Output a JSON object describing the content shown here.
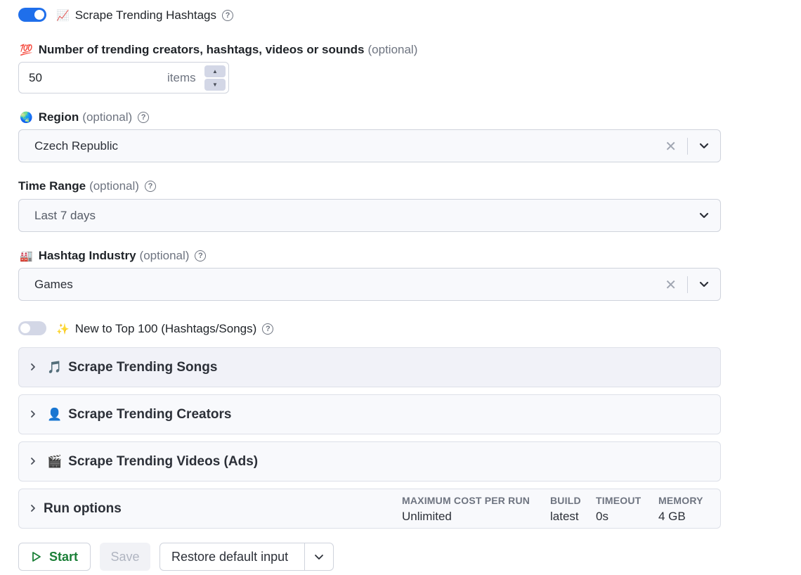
{
  "hashtags_toggle": {
    "label": "Scrape Trending Hashtags",
    "emoji": "📈",
    "enabled": true
  },
  "count_field": {
    "emoji": "💯",
    "label": "Number of trending creators, hashtags, videos or sounds",
    "optional": "(optional)",
    "value": "50",
    "unit": "items"
  },
  "region": {
    "emoji": "🌏",
    "label": "Region",
    "optional": "(optional)",
    "value": "Czech Republic"
  },
  "time_range": {
    "label": "Time Range",
    "optional": "(optional)",
    "value": "Last 7 days"
  },
  "industry": {
    "emoji": "🏭",
    "label": "Hashtag Industry",
    "optional": "(optional)",
    "value": "Games"
  },
  "new_top_toggle": {
    "emoji": "✨",
    "label": "New to Top 100 (Hashtags/Songs)",
    "enabled": false
  },
  "sections": {
    "songs": {
      "emoji": "🎵",
      "title": "Scrape Trending Songs"
    },
    "creators": {
      "emoji": "👤",
      "title": "Scrape Trending Creators"
    },
    "videos": {
      "emoji": "🎬",
      "title": "Scrape Trending Videos (Ads)"
    }
  },
  "run_options": {
    "title": "Run options",
    "max_cost_label": "MAXIMUM COST PER RUN",
    "max_cost_value": "Unlimited",
    "build_label": "BUILD",
    "build_value": "latest",
    "timeout_label": "TIMEOUT",
    "timeout_value": "0s",
    "memory_label": "MEMORY",
    "memory_value": "4 GB"
  },
  "buttons": {
    "start": "Start",
    "save": "Save",
    "restore": "Restore default input"
  },
  "colors": {
    "accent": "#1f6feb",
    "start_green": "#1a7f37"
  }
}
